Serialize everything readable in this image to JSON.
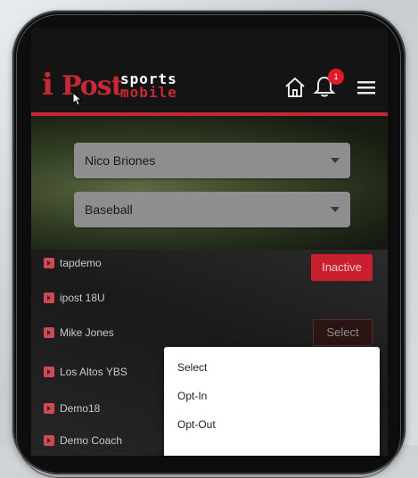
{
  "header": {
    "logo": {
      "mark": "i",
      "post": "Post",
      "sports": "sports",
      "mobile": "mobile"
    },
    "notification_count": "1",
    "icons": {
      "home": "home-icon",
      "bell": "bell-icon",
      "menu": "hamburger-menu-icon"
    },
    "accent_color": "#c62835"
  },
  "filters": {
    "user_select": {
      "value": "Nico Briones"
    },
    "sport_select": {
      "value": "Baseball"
    }
  },
  "teams": [
    {
      "label": "tapdemo"
    },
    {
      "label": "ipost 18U"
    },
    {
      "label": "Mike Jones"
    },
    {
      "label": "Los Altos YBS"
    },
    {
      "label": "Demo18"
    },
    {
      "label": "Demo Coach"
    }
  ],
  "status_button": {
    "label": "Inactive"
  },
  "select_button": {
    "label": "Select"
  },
  "dropdown": {
    "options": [
      "Select",
      "Opt-In",
      "Opt-Out"
    ]
  }
}
